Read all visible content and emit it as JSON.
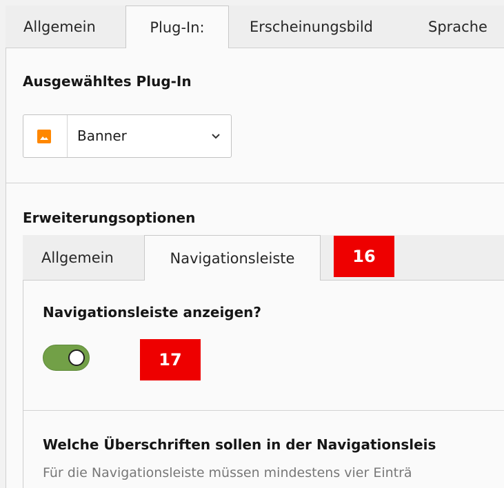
{
  "top_tabs": [
    {
      "label": "Allgemein",
      "active": false
    },
    {
      "label": "Plug-In:",
      "active": true
    },
    {
      "label": "Erscheinungsbild",
      "active": false
    },
    {
      "label": "Sprache",
      "active": false
    }
  ],
  "plugin_section": {
    "title": "Ausgewähltes Plug-In",
    "select_value": "Banner",
    "select_icon": "image-icon"
  },
  "extension_section": {
    "title": "Erweiterungsoptionen",
    "tabs": [
      {
        "label": "Allgemein",
        "active": false
      },
      {
        "label": "Navigationsleiste",
        "active": true
      }
    ],
    "toggle_label": "Navigationsleiste anzeigen?",
    "toggle_on": true,
    "headings_question": "Welche Überschriften sollen in der Navigationsleis",
    "headings_hint": "Für die Navigationsleiste müssen mindestens vier Einträ"
  },
  "badges": {
    "b16": "16",
    "b17": "17"
  },
  "colors": {
    "accent": "#ff8700",
    "toggle_on": "#72a047",
    "badge": "#ee0000"
  }
}
